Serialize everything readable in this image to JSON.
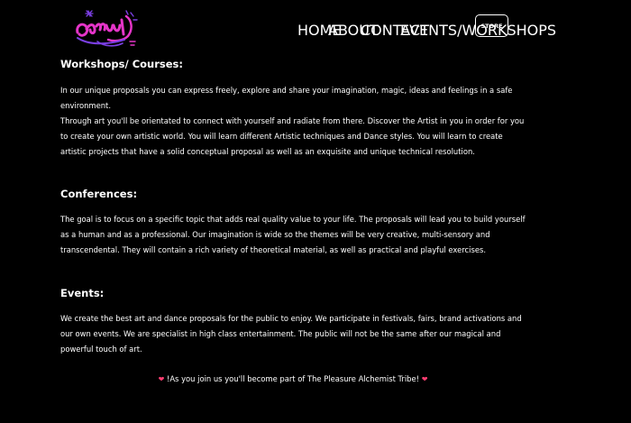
{
  "header": {
    "logo_alt": "Logo",
    "nav": {
      "home": "HOME",
      "about": "ABOUT",
      "contact": "CONTACT",
      "events_workshops": "EVENTS/WORKSHOPS",
      "store": "STORE"
    }
  },
  "sections": {
    "workshops": {
      "title": "Workshops/ Courses:",
      "p1": "In our unique proposals you can express freely, explore and share your imagination, magic, ideas and feelings in a safe environment.",
      "p2": "Through art you'll be orientated to connect with yourself and radiate from there. Discover the Artist in you in order for you to create your own artistic world. You will learn different Artistic techniques and Dance styles. You will learn to create artistic projects that have a solid conceptual proposal as well as an exquisite and unique technical resolution."
    },
    "conferences": {
      "title": "Conferences:",
      "p1": "The goal is to focus on a specific topic that adds real quality value to your life. The proposals will lead you to build yourself as a human and as a professional. Our imagination is wide so the themes will be very creative, multi-sensory and transcendental. They will contain a rich variety of theoretical material, as well as practical and playful exercises."
    },
    "events": {
      "title": "Events:",
      "p1": "We create the best art and dance proposals for the public to enjoy. We participate in festivals, fairs, brand activations and our own events. We are specialist in high class entertainment. The public will not be the same after our magical and powerful touch of art."
    }
  },
  "tagline": "!As you join us you'll become part of The Pleasure Alchemist Tribe!",
  "colors": {
    "background": "#000000",
    "text": "#ffffff",
    "logo_pink": "#e535c9",
    "logo_purple": "#7b3fe4",
    "heart": "#ff3e72"
  },
  "icons": {
    "logo": "neon-script-logo",
    "heart": "heart-icon"
  }
}
